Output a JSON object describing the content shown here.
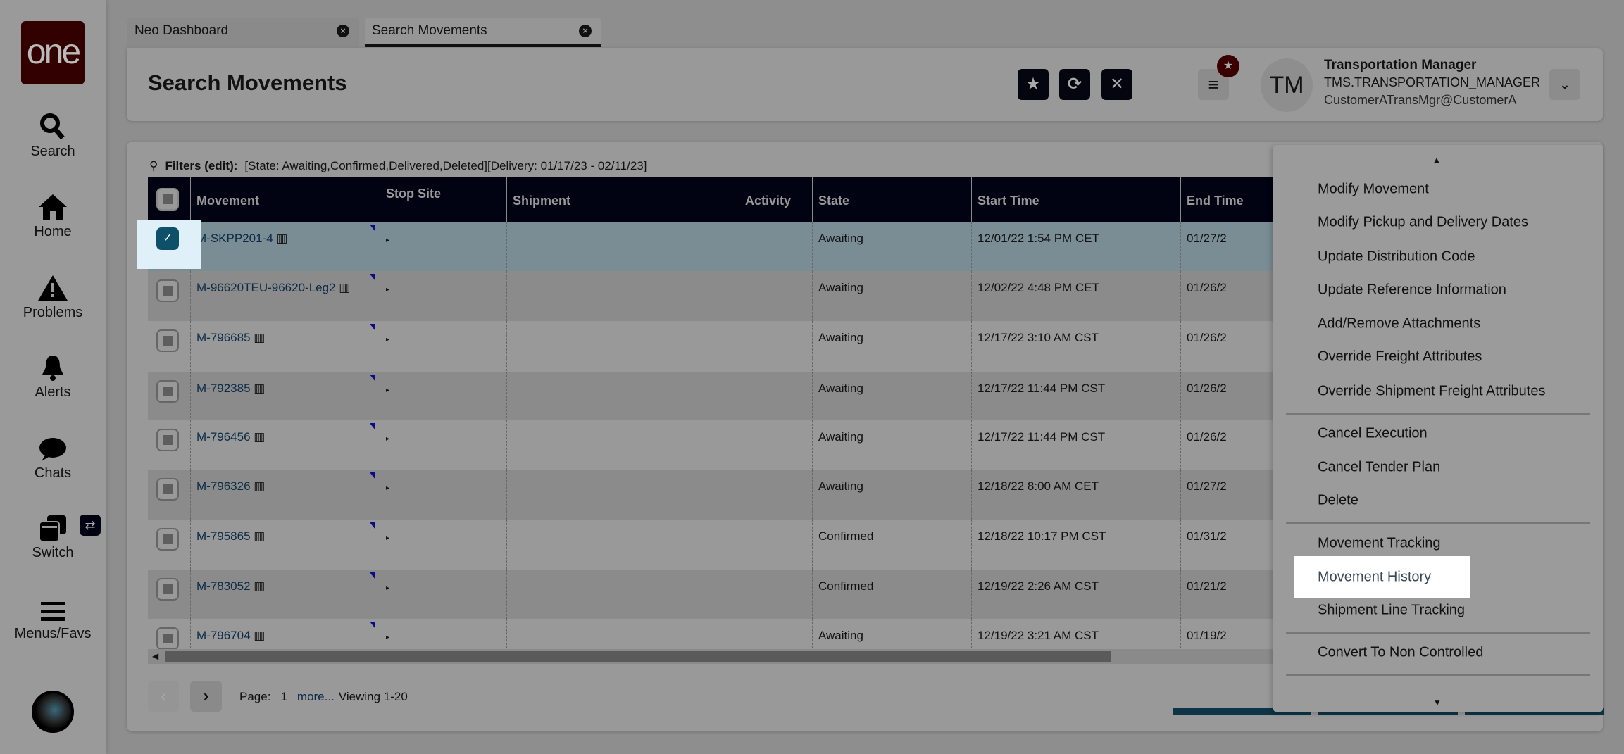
{
  "sidebar": {
    "logo": "one",
    "items": [
      {
        "label": "Search",
        "icon": "search-icon"
      },
      {
        "label": "Home",
        "icon": "home-icon"
      },
      {
        "label": "Problems",
        "icon": "warning-icon"
      },
      {
        "label": "Alerts",
        "icon": "bell-icon"
      },
      {
        "label": "Chats",
        "icon": "chat-icon"
      },
      {
        "label": "Switch",
        "icon": "switch-icon"
      },
      {
        "label": "Menus/Favs",
        "icon": "menu-icon"
      }
    ]
  },
  "tabs": [
    {
      "label": "Neo Dashboard"
    },
    {
      "label": "Search Movements"
    }
  ],
  "header": {
    "title": "Search Movements",
    "user_name": "Transportation Manager",
    "user_role": "TMS.TRANSPORTATION_MANAGER",
    "user_email": "CustomerATransMgr@CustomerA",
    "avatar_initials": "TM"
  },
  "filters": {
    "label": "Filters (edit):",
    "value": "[State: Awaiting,Confirmed,Delivered,Deleted][Delivery: 01/17/23 - 02/11/23]"
  },
  "table": {
    "columns": [
      "Movement",
      "Stop Site",
      "Shipment",
      "Activity",
      "State",
      "Start Time",
      "End Time"
    ],
    "rows": [
      {
        "movement": "M-SKPP201-4",
        "state": "Awaiting",
        "start": "12/01/22 1:54 PM CET",
        "end": "01/27/2",
        "selected": true
      },
      {
        "movement": "M-96620TEU-96620-Leg2",
        "state": "Awaiting",
        "start": "12/02/22 4:48 PM CET",
        "end": "01/26/2"
      },
      {
        "movement": "M-796685",
        "state": "Awaiting",
        "start": "12/17/22 3:10 AM CST",
        "end": "01/26/2"
      },
      {
        "movement": "M-792385",
        "state": "Awaiting",
        "start": "12/17/22 11:44 PM CST",
        "end": "01/26/2"
      },
      {
        "movement": "M-796456",
        "state": "Awaiting",
        "start": "12/17/22 11:44 PM CST",
        "end": "01/26/2"
      },
      {
        "movement": "M-796326",
        "state": "Awaiting",
        "start": "12/18/22 8:00 AM CET",
        "end": "01/27/2"
      },
      {
        "movement": "M-795865",
        "state": "Confirmed",
        "start": "12/18/22 10:17 PM CST",
        "end": "01/31/2"
      },
      {
        "movement": "M-783052",
        "state": "Confirmed",
        "start": "12/19/22 2:26 AM CST",
        "end": "01/21/2"
      },
      {
        "movement": "M-796704",
        "state": "Awaiting",
        "start": "12/19/22 3:21 AM CST",
        "end": "01/19/2"
      }
    ]
  },
  "pagination": {
    "page_label": "Page:",
    "page": "1",
    "more": "more...",
    "viewing": "Viewing 1-20"
  },
  "menu": {
    "items": [
      "Modify Movement",
      "Modify Pickup and Delivery Dates",
      "Update Distribution Code",
      "Update Reference Information",
      "Add/Remove Attachments",
      "Override Freight Attributes",
      "Override Shipment Freight Attributes",
      "Cancel Execution",
      "Cancel Tender Plan",
      "Delete",
      "Movement Tracking",
      "Movement History",
      "Shipment Line Tracking",
      "Convert To Non Controlled"
    ],
    "highlighted": "Movement History"
  }
}
